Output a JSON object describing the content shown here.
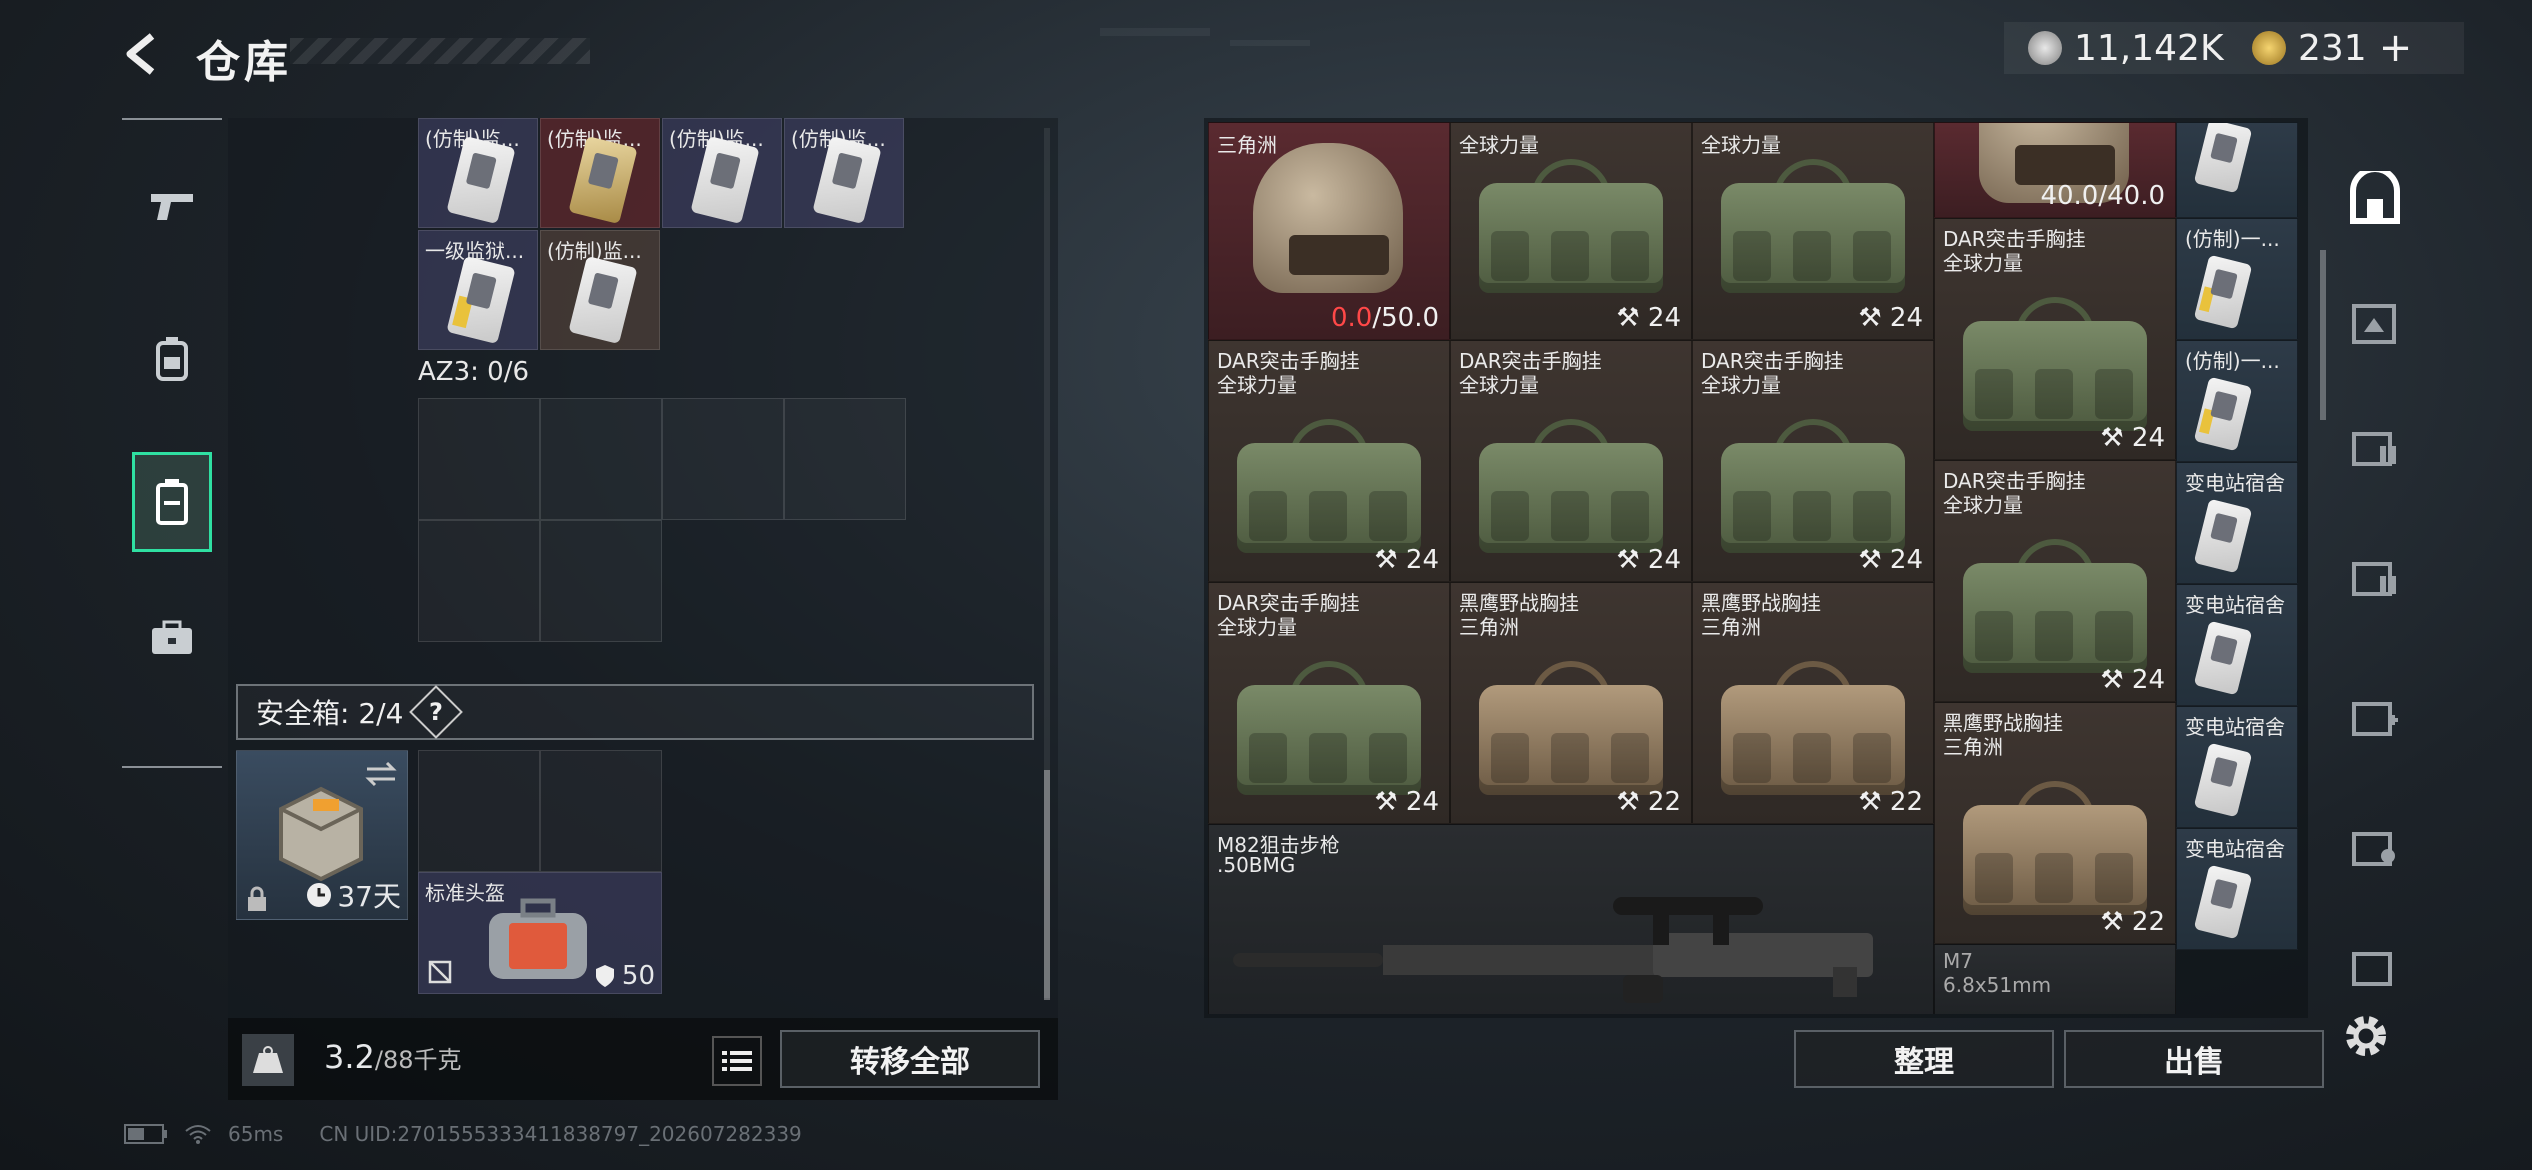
{
  "header": {
    "title": "仓库",
    "currency_silver": "11,142K",
    "currency_gold": "231",
    "currency_add": "+"
  },
  "nav": {
    "items": [
      "weapons-icon",
      "gear-icon",
      "storage-icon",
      "toolbox-icon"
    ],
    "active": "storage-icon"
  },
  "left_panel": {
    "top_row_labels": [
      "(仿制)监...",
      "(仿制)监...",
      "(仿制)监...",
      "(仿制)监..."
    ],
    "second_row_labels": [
      "一级监狱...",
      "(仿制)监..."
    ],
    "az3_label": "AZ3: 0/6",
    "safe_box_label": "安全箱: 2/4",
    "safe_box_help": "?",
    "safe_box_days": "37天",
    "helmet_slot_label": "标准头盔",
    "helmet_slot_value": "50"
  },
  "weight": {
    "current": "3.2",
    "max": "/88千克",
    "transfer_all": "转移全部"
  },
  "stash": {
    "items": [
      {
        "n1": "",
        "n2": "三角洲",
        "dur": "0.0",
        "max": "/50.0",
        "type": "helmet"
      },
      {
        "n1": "",
        "n2": "全球力量",
        "dur": "24",
        "type": "bag"
      },
      {
        "n1": "",
        "n2": "全球力量",
        "dur": "24",
        "type": "bag"
      },
      {
        "n1": "",
        "n2": "",
        "dur": "40.0/40.0",
        "type": "helmet"
      },
      {
        "n1": "DAR突击手胸挂",
        "n2": "全球力量",
        "dur": "24",
        "type": "bag"
      },
      {
        "n1": "DAR突击手胸挂",
        "n2": "全球力量",
        "dur": "24",
        "type": "bag"
      },
      {
        "n1": "DAR突击手胸挂",
        "n2": "全球力量",
        "dur": "24",
        "type": "bag"
      },
      {
        "n1": "DAR突击手胸挂",
        "n2": "全球力量",
        "dur": "24",
        "type": "bag"
      },
      {
        "n1": "DAR突击手胸挂",
        "n2": "全球力量",
        "dur": "24",
        "type": "bag"
      },
      {
        "n1": "DAR突击手胸挂",
        "n2": "全球力量",
        "dur": "24",
        "type": "bag"
      },
      {
        "n1": "黑鹰野战胸挂",
        "n2": "三角洲",
        "dur": "22",
        "type": "bag"
      },
      {
        "n1": "黑鹰野战胸挂",
        "n2": "三角洲",
        "dur": "22",
        "type": "bag"
      },
      {
        "n1": "DAR突击手胸挂",
        "n2": "全球力量",
        "dur": "24",
        "type": "bag"
      },
      {
        "n1": "黑鹰野战胸挂",
        "n2": "三角洲",
        "dur": "22",
        "type": "bag"
      },
      {
        "n1": "M82狙击步枪",
        "n2": ".50BMG",
        "type": "rifle"
      },
      {
        "n1": "M7",
        "n2": "6.8x51mm",
        "type": "rifle"
      }
    ],
    "cards": [
      {
        "label": ""
      },
      {
        "label": "(仿制)一..."
      },
      {
        "label": "(仿制)一..."
      },
      {
        "label": "变电站宿舍"
      },
      {
        "label": "变电站宿舍"
      },
      {
        "label": "变电站宿舍"
      },
      {
        "label": "变电站宿舍"
      }
    ],
    "arrange_button": "整理",
    "sell_button": "出售"
  },
  "side_tools": [
    "container-icon",
    "filter-icon",
    "tier4-ammo-icon",
    "tier4-ammo-icon",
    "tier4-medical-icon",
    "tier4-key-icon",
    "tier4-misc-icon"
  ],
  "status": {
    "ping": "65ms",
    "uid": "CN UID:2701555333411838797_202607282339"
  },
  "colors": {
    "accent": "#2fe0a2",
    "durability_low": "#ff4848"
  }
}
